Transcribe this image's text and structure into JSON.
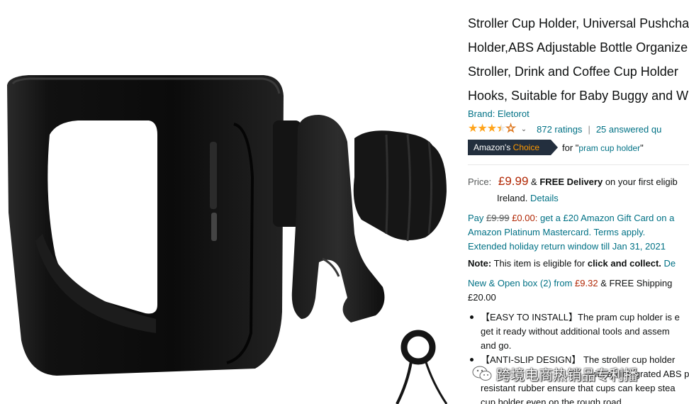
{
  "product": {
    "title_lines": [
      "Stroller Cup Holder, Universal Pushcha",
      "Holder,ABS Adjustable Bottle Organize",
      "Stroller, Drink and Coffee Cup Holder",
      "Hooks, Suitable for Baby Buggy and W"
    ],
    "brand": "Brand: Eletorot"
  },
  "rating": {
    "stars": 3.5,
    "ratings_text": "872 ratings",
    "separator": "|",
    "answered_text": "25 answered qu"
  },
  "choice": {
    "badge_prefix": "Amazon's",
    "badge_choice": "Choice",
    "for_text": "for \"",
    "term": "pram cup holder",
    "close_quote": "\""
  },
  "price": {
    "label": "Price:",
    "value": "£9.99",
    "amp": "&",
    "free_delivery": "FREE Delivery",
    "delivery_rest": "on your first eligib",
    "location": "Ireland.",
    "details_link": "Details"
  },
  "promo": {
    "pay_word": "Pay",
    "old_price": "£9.99",
    "new_price": "£0.00:",
    "line1_rest": "get a £20 Amazon Gift Card on a",
    "line2": "Amazon Platinum Mastercard. Terms apply.",
    "line3": "Extended holiday return window till Jan 31, 2021"
  },
  "note": {
    "label": "Note:",
    "text": "This item is eligible for",
    "bold": "click and collect.",
    "link": "De"
  },
  "used": {
    "link": "New & Open box (2) from",
    "price": "£9.32",
    "shipping": "& FREE Shipping",
    "line2": "£20.00"
  },
  "bullets": [
    {
      "lines": [
        "【EASY TO INSTALL】The pram cup holder is e",
        "get it ready without additional tools and assem",
        "and go."
      ]
    },
    {
      "lines": [
        "【ANTI-SLIP DESIGN】 The stroller cup holder",
        "with an integrated ABS pl",
        "resistant rubber ensure that cups can keep stea",
        "cup holder even on the rough road"
      ]
    }
  ],
  "watermark": {
    "text": "跨境电商热销品专利播"
  },
  "colors": {
    "link": "#007185",
    "price": "#b12704",
    "star": "#ffa41c",
    "badge_bg": "#232f3e",
    "badge_choice": "#ff9900"
  }
}
